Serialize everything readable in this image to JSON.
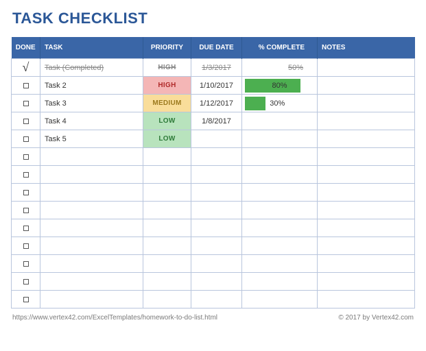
{
  "title": "TASK CHECKLIST",
  "columns": {
    "done": "DONE",
    "task": "TASK",
    "priority": "PRIORITY",
    "due": "DUE DATE",
    "complete": "% COMPLETE",
    "notes": "NOTES"
  },
  "rows": [
    {
      "done": true,
      "task": "Task (Completed)",
      "priority": "HIGH",
      "due": "1/3/2017",
      "complete": 50,
      "bar": false,
      "notes": "",
      "completed": true
    },
    {
      "done": false,
      "task": "Task 2",
      "priority": "HIGH",
      "due": "1/10/2017",
      "complete": 80,
      "bar": true,
      "label_inside": true,
      "notes": "",
      "completed": false
    },
    {
      "done": false,
      "task": "Task 3",
      "priority": "MEDIUM",
      "due": "1/12/2017",
      "complete": 30,
      "bar": true,
      "label_inside": false,
      "notes": "",
      "completed": false
    },
    {
      "done": false,
      "task": "Task 4",
      "priority": "LOW",
      "due": "1/8/2017",
      "complete": null,
      "bar": false,
      "notes": "",
      "completed": false
    },
    {
      "done": false,
      "task": "Task 5",
      "priority": "LOW",
      "due": "",
      "complete": null,
      "bar": false,
      "notes": "",
      "completed": false
    },
    {
      "done": false,
      "task": "",
      "priority": "",
      "due": "",
      "complete": null,
      "bar": false,
      "notes": "",
      "completed": false
    },
    {
      "done": false,
      "task": "",
      "priority": "",
      "due": "",
      "complete": null,
      "bar": false,
      "notes": "",
      "completed": false
    },
    {
      "done": false,
      "task": "",
      "priority": "",
      "due": "",
      "complete": null,
      "bar": false,
      "notes": "",
      "completed": false
    },
    {
      "done": false,
      "task": "",
      "priority": "",
      "due": "",
      "complete": null,
      "bar": false,
      "notes": "",
      "completed": false
    },
    {
      "done": false,
      "task": "",
      "priority": "",
      "due": "",
      "complete": null,
      "bar": false,
      "notes": "",
      "completed": false
    },
    {
      "done": false,
      "task": "",
      "priority": "",
      "due": "",
      "complete": null,
      "bar": false,
      "notes": "",
      "completed": false
    },
    {
      "done": false,
      "task": "",
      "priority": "",
      "due": "",
      "complete": null,
      "bar": false,
      "notes": "",
      "completed": false
    },
    {
      "done": false,
      "task": "",
      "priority": "",
      "due": "",
      "complete": null,
      "bar": false,
      "notes": "",
      "completed": false
    },
    {
      "done": false,
      "task": "",
      "priority": "",
      "due": "",
      "complete": null,
      "bar": false,
      "notes": "",
      "completed": false
    }
  ],
  "footer": {
    "left": "https://www.vertex42.com/ExcelTemplates/homework-to-do-list.html",
    "right": "© 2017 by Vertex42.com"
  },
  "chart_data": {
    "type": "table",
    "title": "TASK CHECKLIST",
    "columns": [
      "DONE",
      "TASK",
      "PRIORITY",
      "DUE DATE",
      "% COMPLETE",
      "NOTES"
    ],
    "rows": [
      [
        "✓",
        "Task (Completed)",
        "HIGH",
        "1/3/2017",
        "50%",
        ""
      ],
      [
        "",
        "Task 2",
        "HIGH",
        "1/10/2017",
        "80%",
        ""
      ],
      [
        "",
        "Task 3",
        "MEDIUM",
        "1/12/2017",
        "30%",
        ""
      ],
      [
        "",
        "Task 4",
        "LOW",
        "1/8/2017",
        "",
        ""
      ],
      [
        "",
        "Task 5",
        "LOW",
        "",
        "",
        ""
      ]
    ]
  }
}
